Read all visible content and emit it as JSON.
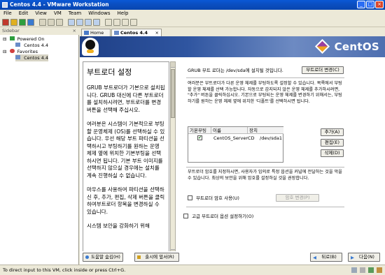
{
  "window": {
    "title": "Centos 4.4 - VMware Workstation"
  },
  "menu": [
    "File",
    "Edit",
    "View",
    "VM",
    "Team",
    "Windows",
    "Help"
  ],
  "sidebar": {
    "title": "Sidebar",
    "groups": [
      {
        "label": "Powered On",
        "items": [
          "Centos 4.4"
        ]
      },
      {
        "label": "Favorites",
        "items": [
          "Centos 4.4"
        ]
      }
    ]
  },
  "tabs": [
    {
      "label": "Home"
    },
    {
      "label": "Centos 4.4"
    }
  ],
  "installer": {
    "logo": "CentOS",
    "help_title": "부트로더 설정",
    "help_paragraphs": [
      "GRUB 부트로더가 기본으로 설치됩니다. GRUB 대신에 다른 부트로더를 설치하시려면, 부트로더를 변경 버튼을 선택해 주십시오.",
      "여러분은 시스템이 기본적으로 부팅할 운영체제 (OS)를 선택하실 수 있습니다. 우선 해당 부트 파티션을 선택하시고 부팅하기를 원하는 운영 체제 옆에 위치한 기본부팅을 선택하시면 됩니다. 기본 부트 이미지를 선택하지 않으실 경우에는 설치를 계속 진행하실 수 없습니다.",
      "마우스를 사용하여 파티션을 선택하신 후, 추가, 편집, 삭제 버튼을 클릭하여부트로더 항목을 변경하실 수 있습니다.",
      "시스템 보안을 강화하기 위해"
    ],
    "grub_text": "GRUB 부트 로더는 /dev/sda에 설치될 것입니다.",
    "change_bootloader": "부트로더 변경(C)",
    "desc": "여러분은 부트로더가 다른 운영 체제를 부팅하도록 설정할 수 있습니다. 목록에서 부팅할 운영 체제를 선택 가능합니다. 자동으로 감지되지 않은 운영 체제를 추가하시려면, \"추가\" 버튼을 클릭하십시오. 기본으로 부팅되는 운영 체제를 변경하기 위해서는, 부팅하기를 원하는 운영 체제 옆에 위치한 '디폴트'를 선택하시면 됩니다.",
    "table": {
      "headers": [
        "기본부팅",
        "이름",
        "장치"
      ],
      "rows": [
        {
          "default": "✔",
          "name": "CentOS_ServerCD",
          "device": "/dev/sda1"
        }
      ]
    },
    "add": "추가(A)",
    "edit": "편집(E)",
    "delete": "삭제(D)",
    "pw_desc": "부트로더 암호를 지정하시면, 사용자가 임의로 특정 옵션을 커널에 전달하는 것을 막을 수 있습니다. 최상의 보안을 위해 암호를 설정하실 것을 권장합니다.",
    "use_password": "부트로더 암호 사용(U)",
    "change_password": "암호 변경(P)",
    "advanced": "고급 부트로더 옵션 설정하기(O)",
    "help_btn": "도움말 숨김(H)",
    "release_notes": "출시에 앞서(R)",
    "back": "뒤로(B)",
    "next": "다음(N)"
  },
  "status": "To direct input to this VM, click inside or press Ctrl+G."
}
